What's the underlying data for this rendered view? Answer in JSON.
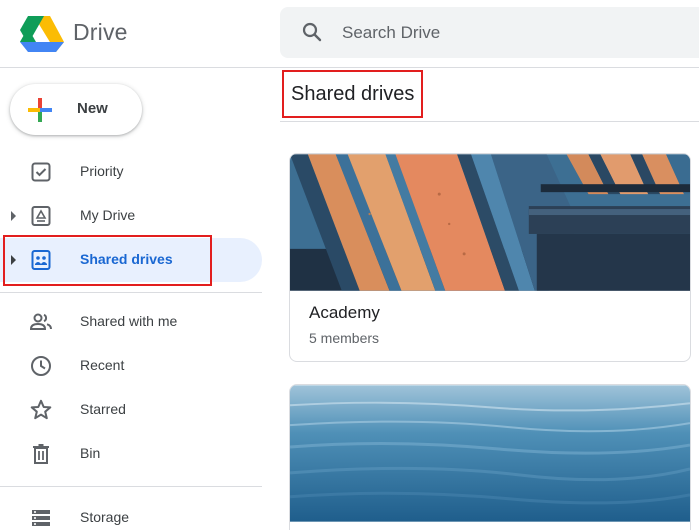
{
  "app": {
    "name": "Drive"
  },
  "search": {
    "placeholder": "Search Drive"
  },
  "new_button": {
    "label": "New"
  },
  "sidebar": {
    "items": [
      {
        "label": "Priority",
        "icon": "checkbox-icon"
      },
      {
        "label": "My Drive",
        "icon": "my-drive-icon"
      },
      {
        "label": "Shared drives",
        "icon": "shared-drives-icon",
        "active": true
      },
      {
        "label": "Shared with me",
        "icon": "people-icon"
      },
      {
        "label": "Recent",
        "icon": "clock-icon"
      },
      {
        "label": "Starred",
        "icon": "star-icon"
      },
      {
        "label": "Bin",
        "icon": "trash-icon"
      },
      {
        "label": "Storage",
        "icon": "storage-icon"
      }
    ]
  },
  "main": {
    "title": "Shared drives",
    "drives": [
      {
        "name": "Academy",
        "members": "5 members",
        "theme": "books"
      },
      {
        "name": "",
        "members": "",
        "theme": "water"
      }
    ]
  },
  "colors": {
    "accent": "#1967d2",
    "active_bg": "#e8f0fe",
    "highlight": "#e21e1e"
  }
}
